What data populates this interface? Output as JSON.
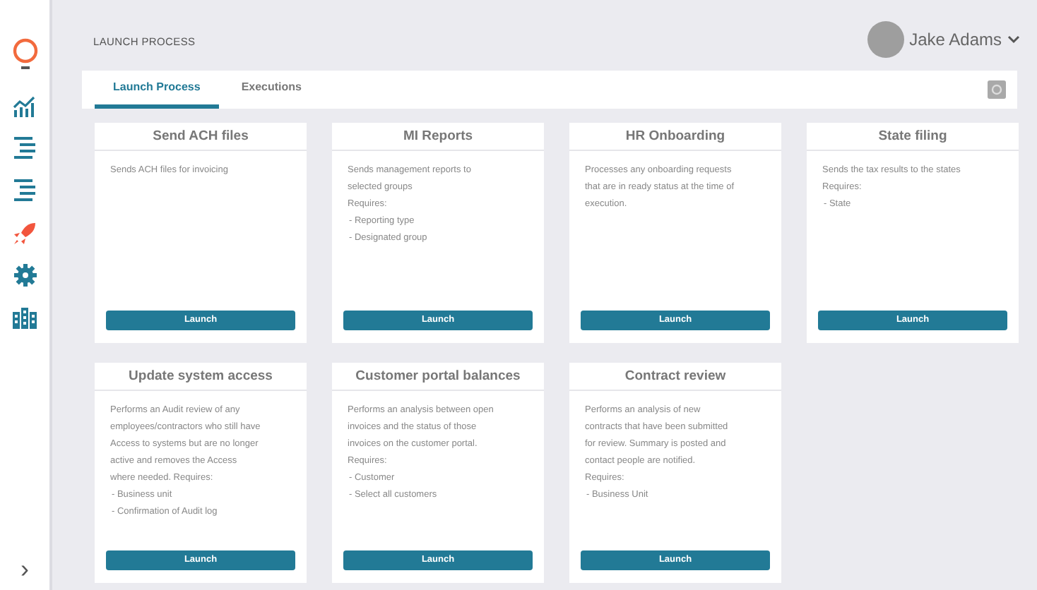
{
  "sidebar": {
    "items": [
      {
        "kind": "chart"
      },
      {
        "kind": "list"
      },
      {
        "kind": "list"
      },
      {
        "kind": "rocket"
      },
      {
        "kind": "gear"
      },
      {
        "kind": "building"
      }
    ],
    "expand": "›"
  },
  "page_title": "LAUNCH PROCESS",
  "user": {
    "name": "Jake Adams"
  },
  "tabs": [
    {
      "label": "Launch Process",
      "selected": true
    },
    {
      "label": "Executions",
      "selected": false
    }
  ],
  "cards": [
    {
      "title": "Send ACH files",
      "paragraphs": [
        "Sends ACH files for invoicing"
      ],
      "button": "Launch"
    },
    {
      "title": "MI Reports",
      "paragraphs": [
        "Sends management reports to selected groups",
        "Requires:"
      ],
      "requirements": [
        "- Reporting type",
        "- Designated group"
      ],
      "button": "Launch"
    },
    {
      "title": "HR Onboarding",
      "paragraphs": [
        "Processes any onboarding requests that are in ready status at the time of execution."
      ],
      "button": "Launch"
    },
    {
      "title": "State filing",
      "paragraphs": [
        "Sends the tax results to the states",
        "Requires:"
      ],
      "requirements": [
        "- State"
      ],
      "button": "Launch"
    },
    {
      "title": "Update system access",
      "paragraphs": [
        "Performs an Audit review of any employees/contractors who still have Access to systems but are no longer active and removes the Access where needed. Requires:"
      ],
      "requirements": [
        "- Business unit",
        "- Confirmation of Audit log"
      ],
      "button": "Launch"
    },
    {
      "title": "Customer portal balances",
      "paragraphs": [
        "Performs an analysis between open invoices and the status of those invoices on the customer portal.",
        "Requires:"
      ],
      "requirements": [
        "- Customer",
        "- Select all customers"
      ],
      "button": "Launch"
    },
    {
      "title": "Contract review",
      "paragraphs": [
        "Performs an analysis of new contracts that have been submitted for review. Summary is posted and contact people are notified.",
        "Requires:"
      ],
      "requirements": [
        "- Business Unit"
      ],
      "button": "Launch"
    }
  ]
}
